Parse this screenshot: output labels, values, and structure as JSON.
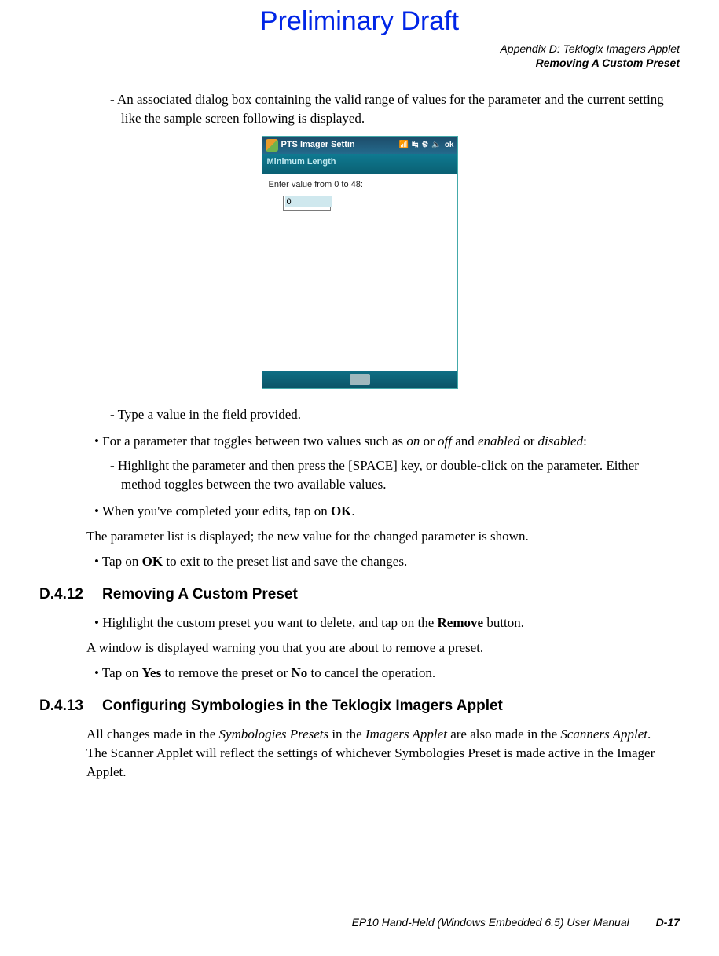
{
  "preliminary_title": "Preliminary Draft",
  "header": {
    "line1": "Appendix D: Teklogix Imagers Applet",
    "line2": "Removing A Custom Preset"
  },
  "content": {
    "dash1": "An associated dialog box containing the valid range of values for the parameter and the current setting like the sample screen following is displayed.",
    "dash2": "Type a value in the field provided.",
    "bullet1_pre": "For a parameter that toggles between two values such as ",
    "bullet1_on": "on",
    "bullet1_or1": " or ",
    "bullet1_off": "off",
    "bullet1_and": " and ",
    "bullet1_enabled": "enabled",
    "bullet1_or2": " or ",
    "bullet1_disabled": "disabled",
    "bullet1_colon": ":",
    "dash3": "Highlight the parameter and then press the [SPACE] key, or double-click on the parameter. Either method toggles between the two available values.",
    "bullet2_pre": "When you've completed your edits, tap on ",
    "bullet2_ok": "OK",
    "bullet2_post": ".",
    "para1": "The parameter list is displayed; the new value for the changed parameter is shown.",
    "bullet3_pre": "Tap on ",
    "bullet3_ok": "OK",
    "bullet3_post": " to exit to the preset list and save the changes."
  },
  "section12": {
    "num": "D.4.12",
    "title": "Removing A Custom Preset",
    "bullet_pre": "Highlight the custom preset you want to delete, and tap on the ",
    "bullet_remove": "Remove",
    "bullet_post": " button.",
    "para1": "A window is displayed warning you that you are about to remove a preset.",
    "bullet2_pre": "Tap on ",
    "bullet2_yes": "Yes",
    "bullet2_mid": " to remove the preset or ",
    "bullet2_no": "No",
    "bullet2_post": " to cancel the operation."
  },
  "section13": {
    "num": "D.4.13",
    "title": "Configuring Symbologies in the Teklogix Imagers Applet",
    "para_pre": "All changes made in the ",
    "para_i1": "Symbologies Presets",
    "para_mid1": " in the ",
    "para_i2": "Imagers Applet",
    "para_mid2": " are also made in the ",
    "para_i3": "Scanners Applet",
    "para_post": ". The Scanner Applet will reflect the settings of whichever Symbologies Preset is made active in the Imager Applet."
  },
  "screenshot": {
    "window_title": "PTS Imager Settin",
    "ok_label": "ok",
    "subtitle": "Minimum Length",
    "prompt": "Enter value from 0 to 48:",
    "input_value": "0"
  },
  "footer": {
    "manual": "EP10 Hand-Held (Windows Embedded 6.5) User Manual",
    "page": "D-17"
  }
}
